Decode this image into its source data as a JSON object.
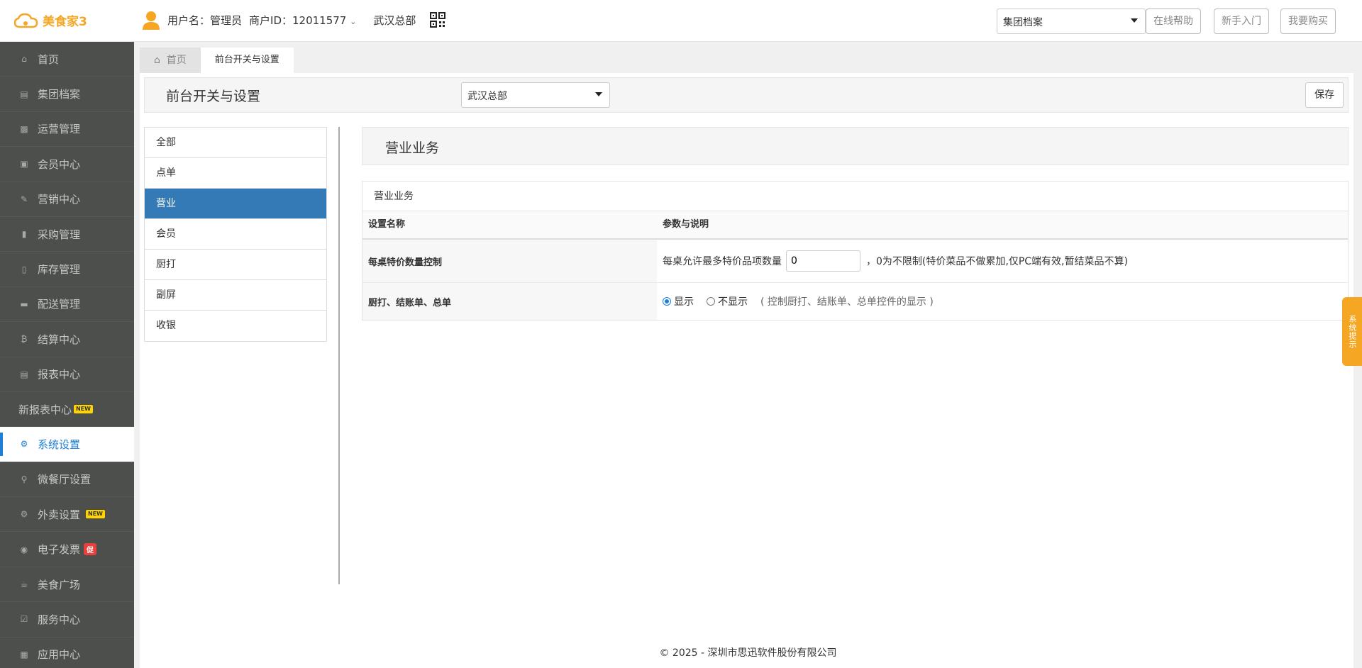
{
  "header": {
    "logo_text": "美食家3",
    "username": "用户名：管理员",
    "merchant_id": "商户ID：12011577",
    "location": "武汉总部",
    "archive_select": "集团档案",
    "help_btn": "在线帮助",
    "newbie_btn": "新手入门",
    "buy_btn": "我要购买"
  },
  "sidebar": {
    "items": [
      {
        "label": "首页",
        "icon": "home-icon"
      },
      {
        "label": "集团档案",
        "icon": "document-icon"
      },
      {
        "label": "运营管理",
        "icon": "bar-chart-icon"
      },
      {
        "label": "会员中心",
        "icon": "id-card-icon"
      },
      {
        "label": "营销中心",
        "icon": "edit-icon"
      },
      {
        "label": "采购管理",
        "icon": "book-icon"
      },
      {
        "label": "库存管理",
        "icon": "phone-icon"
      },
      {
        "label": "配送管理",
        "icon": "truck-icon"
      },
      {
        "label": "结算中心",
        "icon": "bitcoin-icon"
      },
      {
        "label": "报表中心",
        "icon": "report-icon"
      },
      {
        "label": "新报表中心",
        "badge": "NEW"
      },
      {
        "label": "系统设置",
        "icon": "cogs-icon"
      },
      {
        "label": "微餐厅设置",
        "icon": "cutlery-icon"
      },
      {
        "label": "外卖设置",
        "icon": "gear-icon",
        "badge": "NEW"
      },
      {
        "label": "电子发票",
        "icon": "circle-icon",
        "badge": "促"
      },
      {
        "label": "美食广场",
        "icon": "coffee-icon"
      },
      {
        "label": "服务中心",
        "icon": "check-square-icon"
      },
      {
        "label": "应用中心",
        "icon": "grid-icon"
      }
    ]
  },
  "tabs": {
    "home": "首页",
    "current": "前台开关与设置"
  },
  "page": {
    "title": "前台开关与设置",
    "store_select": "武汉总部",
    "save_btn": "保存"
  },
  "categories": [
    "全部",
    "点单",
    "营业",
    "会员",
    "厨打",
    "副屏",
    "收银"
  ],
  "section": {
    "title": "营业业务",
    "caption": "营业业务",
    "col_name": "设置名称",
    "col_param": "参数与说明",
    "rows": [
      {
        "name": "每桌特价数量控制",
        "prefix": "每桌允许最多特价品项数量",
        "input_value": "0",
        "suffix": "，0为不限制(特价菜品不做累加,仅PC端有效,暂结菜品不算)"
      },
      {
        "name": "厨打、结账单、总单",
        "opt_show": "显示",
        "opt_hide": "不显示",
        "hint": "( 控制厨打、结账单、总单控件的显示 )"
      }
    ]
  },
  "footer": "© 2025 - 深圳市思迅软件股份有限公司",
  "float_tip": "系统提示",
  "colors": {
    "sidebar_bg": "#4c4f4c",
    "accent": "#1e7fd6",
    "active_category": "#337ab7",
    "brand_orange": "#f5a623"
  }
}
